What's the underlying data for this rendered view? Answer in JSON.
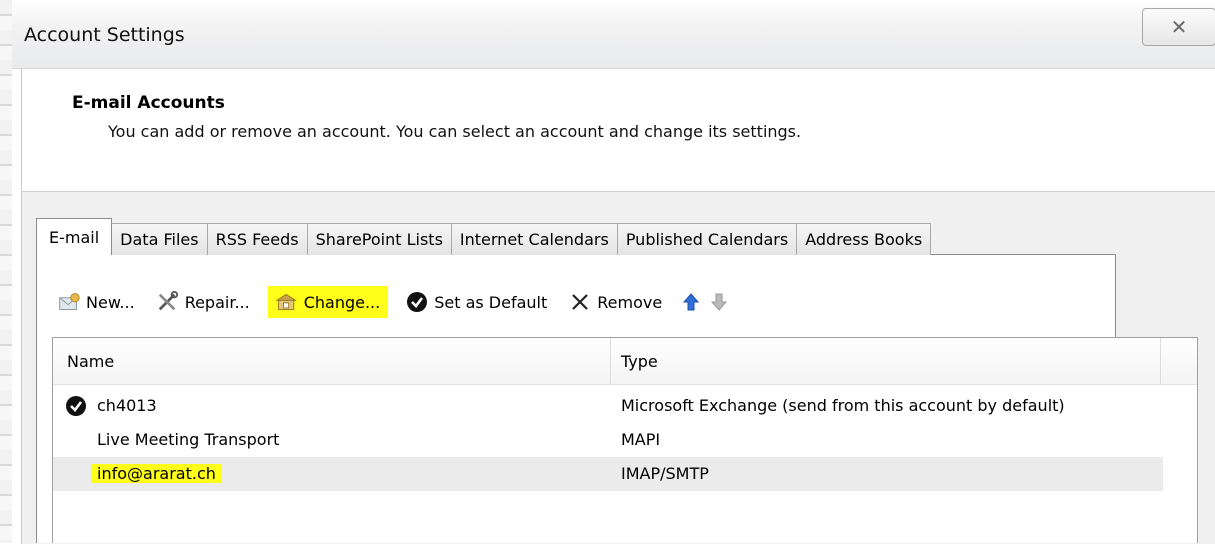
{
  "window": {
    "title": "Account Settings",
    "close_glyph": "✕"
  },
  "header": {
    "title": "E-mail Accounts",
    "description": "You can add or remove an account. You can select an account and change its settings."
  },
  "tabs": [
    {
      "label": "E-mail",
      "active": true
    },
    {
      "label": "Data Files"
    },
    {
      "label": "RSS Feeds"
    },
    {
      "label": "SharePoint Lists"
    },
    {
      "label": "Internet Calendars"
    },
    {
      "label": "Published Calendars"
    },
    {
      "label": "Address Books"
    }
  ],
  "toolbar": {
    "new_label": "New...",
    "repair_label": "Repair...",
    "change_label": "Change...",
    "set_default_label": "Set as Default",
    "remove_label": "Remove"
  },
  "list": {
    "columns": {
      "name": "Name",
      "type": "Type"
    },
    "rows": [
      {
        "name": "ch4013",
        "type": "Microsoft Exchange (send from this account by default)",
        "default": true
      },
      {
        "name": "Live Meeting Transport",
        "type": "MAPI"
      },
      {
        "name": "info@ararat.ch",
        "type": "IMAP/SMTP",
        "selected": true
      }
    ]
  },
  "colors": {
    "highlight": "#ffff1a",
    "accent_arrow": "#2f6fd6"
  }
}
